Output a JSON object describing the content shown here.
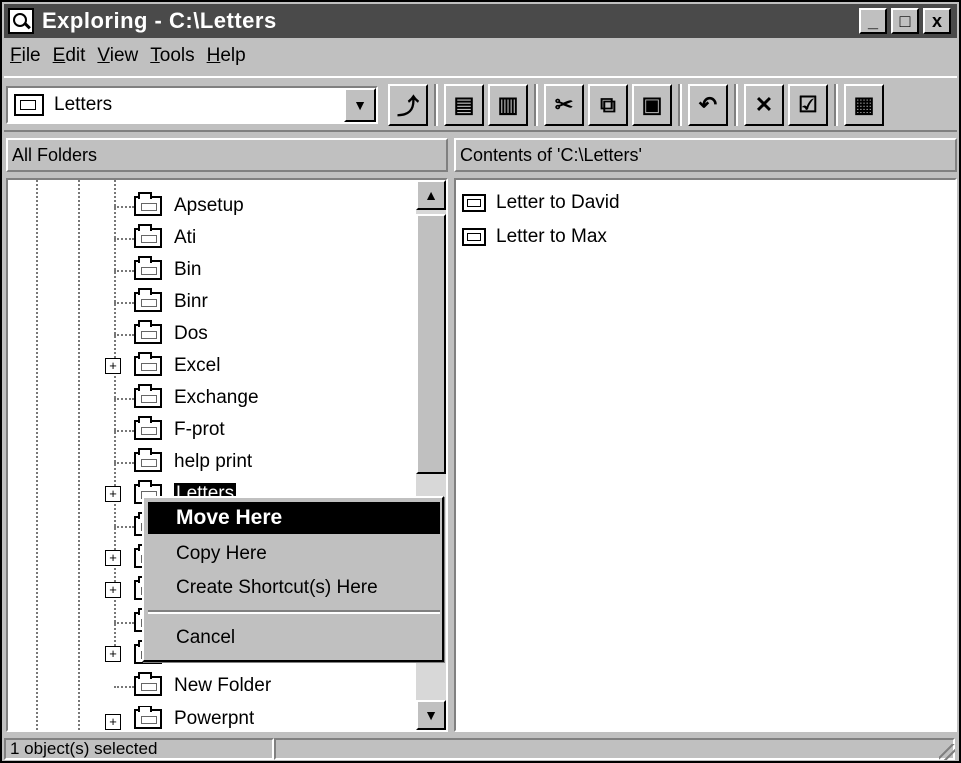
{
  "window": {
    "title": "Exploring - C:\\Letters"
  },
  "window_buttons": {
    "minimize": "_",
    "maximize": "□",
    "close": "x"
  },
  "menu": [
    {
      "pre": "",
      "ul": "F",
      "post": "ile"
    },
    {
      "pre": "",
      "ul": "E",
      "post": "dit"
    },
    {
      "pre": "",
      "ul": "V",
      "post": "iew"
    },
    {
      "pre": "",
      "ul": "T",
      "post": "ools"
    },
    {
      "pre": "",
      "ul": "H",
      "post": "elp"
    }
  ],
  "toolbar": {
    "address_value": "Letters",
    "icons": [
      "up-folder-icon",
      "map-drive-icon",
      "disconnect-drive-icon",
      "cut-icon",
      "copy-icon",
      "paste-icon",
      "undo-icon",
      "delete-icon",
      "properties-icon",
      "large-icons-icon"
    ]
  },
  "left_pane": {
    "header": "All Folders",
    "folders": [
      "Apsetup",
      "Ati",
      "Bin",
      "Binr",
      "Dos",
      "Excel",
      "Exchange",
      "F-prot",
      "help print",
      "Letters",
      "New Folder",
      "Powerpnt"
    ],
    "selected": "Letters"
  },
  "right_pane": {
    "header": "Contents of 'C:\\Letters'",
    "files": [
      "Letter to David",
      "Letter to Max"
    ]
  },
  "context_menu": {
    "items": [
      "Move Here",
      "Copy Here",
      "Create Shortcut(s) Here",
      "Cancel"
    ],
    "active": "Move Here"
  },
  "status": {
    "text": "1 object(s) selected"
  }
}
